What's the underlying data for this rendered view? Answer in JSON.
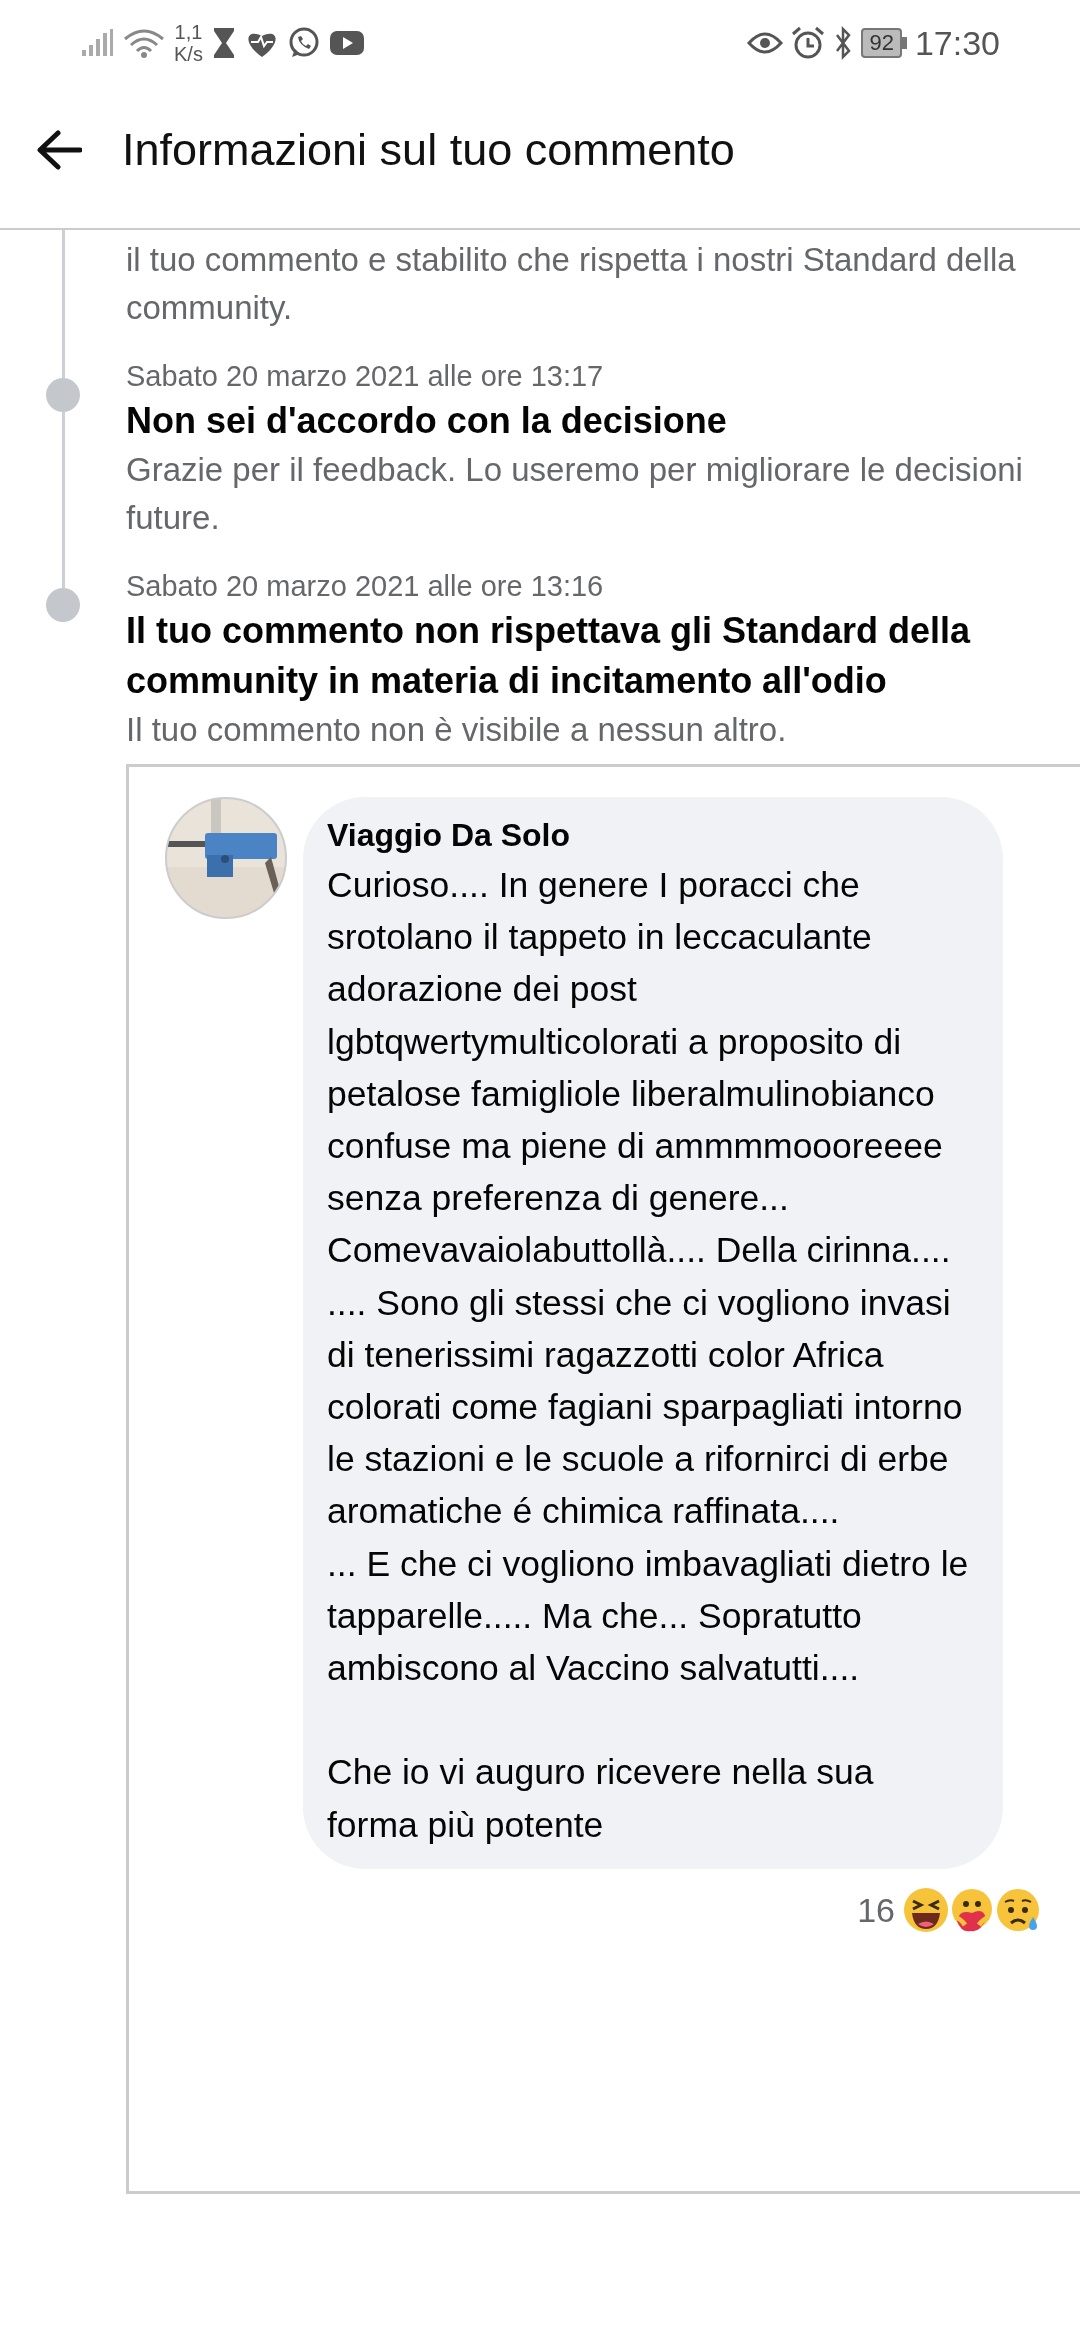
{
  "status_bar": {
    "network_speed": [
      "1,1",
      "K/s"
    ],
    "battery": "92",
    "time": "17:30"
  },
  "header": {
    "title": "Informazioni sul tuo commento"
  },
  "timeline": [
    {
      "text": "il tuo commento e stabilito che rispetta i nostri Standard della community."
    },
    {
      "date": "Sabato 20 marzo 2021 alle ore 13:17",
      "title": "Non sei d'accordo con la decisione",
      "text": "Grazie per il feedback. Lo useremo per migliorare le decisioni future."
    },
    {
      "date": "Sabato 20 marzo 2021 alle ore 13:16",
      "title": "Il tuo commento non rispettava gli Standard della community in materia di incitamento all'odio",
      "text": "Il tuo commento non è visibile a nessun altro."
    }
  ],
  "comment": {
    "author": "Viaggio Da Solo",
    "text": "Curioso.... In genere I poracci che srotolano il tappeto in leccaculante adorazione dei post lgbtqwertymulticolorati a proposito di petalose famigliole liberalmulinobianco confuse ma piene di ammmmoooreeee senza preferenza di genere... Comevavaiolabuttollà.... Della cirinna....\n.... Sono gli stessi che ci vogliono invasi di tenerissimi ragazzotti color Africa colorati come fagiani sparpagliati intorno le stazioni e le scuole a rifornirci di erbe aromatiche é chimica raffinata....\n... E che ci vogliono imbavagliati dietro le tapparelle..... Ma che... Sopratutto ambiscono al Vaccino salvatutti....\n\nChe io vi auguro ricevere nella sua forma più potente",
    "reaction_count": "16"
  }
}
